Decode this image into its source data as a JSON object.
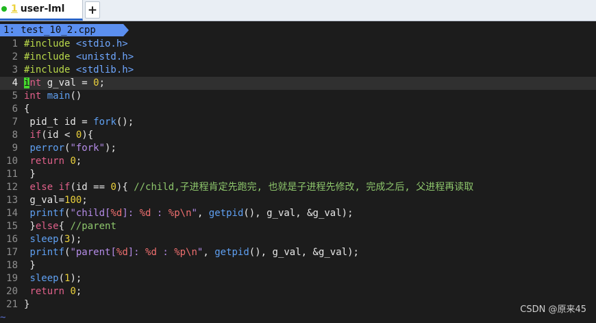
{
  "tabs": [
    {
      "number": "1",
      "label": "user-lml",
      "status_color": "#1fb81f"
    }
  ],
  "new_tab_label": "+",
  "buffer": {
    "label": "1: test_10_2.cpp",
    "color": "#5b8ff0"
  },
  "current_line": 4,
  "lines": [
    {
      "n": "1",
      "tokens": [
        {
          "t": "pre",
          "v": "#include "
        },
        {
          "t": "hdr",
          "v": "<stdio.h>"
        }
      ]
    },
    {
      "n": "2",
      "tokens": [
        {
          "t": "pre",
          "v": "#include "
        },
        {
          "t": "hdr",
          "v": "<unistd.h>"
        }
      ]
    },
    {
      "n": "3",
      "tokens": [
        {
          "t": "pre",
          "v": "#include "
        },
        {
          "t": "hdr",
          "v": "<stdlib.h>"
        }
      ]
    },
    {
      "n": "4",
      "tokens": [
        {
          "t": "cursor",
          "v": "i"
        },
        {
          "t": "kw",
          "v": "nt"
        },
        {
          "t": "pl",
          "v": " g_val = "
        },
        {
          "t": "num",
          "v": "0"
        },
        {
          "t": "pl",
          "v": ";"
        }
      ]
    },
    {
      "n": "5",
      "tokens": [
        {
          "t": "kw",
          "v": "int"
        },
        {
          "t": "pl",
          "v": " "
        },
        {
          "t": "fn",
          "v": "main"
        },
        {
          "t": "pl",
          "v": "()"
        }
      ]
    },
    {
      "n": "6",
      "tokens": [
        {
          "t": "pl",
          "v": "{"
        }
      ]
    },
    {
      "n": "7",
      "tokens": [
        {
          "t": "pl",
          "v": " pid_t id = "
        },
        {
          "t": "fn",
          "v": "fork"
        },
        {
          "t": "pl",
          "v": "();"
        }
      ]
    },
    {
      "n": "8",
      "tokens": [
        {
          "t": "pl",
          "v": " "
        },
        {
          "t": "kw",
          "v": "if"
        },
        {
          "t": "pl",
          "v": "(id < "
        },
        {
          "t": "num",
          "v": "0"
        },
        {
          "t": "pl",
          "v": "){"
        }
      ]
    },
    {
      "n": "9",
      "tokens": [
        {
          "t": "pl",
          "v": " "
        },
        {
          "t": "fn",
          "v": "perror"
        },
        {
          "t": "pl",
          "v": "("
        },
        {
          "t": "str",
          "v": "\"fork\""
        },
        {
          "t": "pl",
          "v": ");"
        }
      ]
    },
    {
      "n": "10",
      "tokens": [
        {
          "t": "pl",
          "v": " "
        },
        {
          "t": "kw",
          "v": "return"
        },
        {
          "t": "pl",
          "v": " "
        },
        {
          "t": "num",
          "v": "0"
        },
        {
          "t": "pl",
          "v": ";"
        }
      ]
    },
    {
      "n": "11",
      "tokens": [
        {
          "t": "pl",
          "v": " }"
        }
      ]
    },
    {
      "n": "12",
      "tokens": [
        {
          "t": "pl",
          "v": " "
        },
        {
          "t": "kw",
          "v": "else"
        },
        {
          "t": "pl",
          "v": " "
        },
        {
          "t": "kw",
          "v": "if"
        },
        {
          "t": "pl",
          "v": "(id == "
        },
        {
          "t": "num",
          "v": "0"
        },
        {
          "t": "pl",
          "v": "){ "
        },
        {
          "t": "cm",
          "v": "//child,子进程肯定先跑完, 也就是子进程先修改, 完成之后, 父进程再读取"
        }
      ]
    },
    {
      "n": "13",
      "tokens": [
        {
          "t": "pl",
          "v": " g_val="
        },
        {
          "t": "num",
          "v": "100"
        },
        {
          "t": "pl",
          "v": ";"
        }
      ]
    },
    {
      "n": "14",
      "tokens": [
        {
          "t": "pl",
          "v": " "
        },
        {
          "t": "fn",
          "v": "printf"
        },
        {
          "t": "pl",
          "v": "("
        },
        {
          "t": "str",
          "v": "\"child["
        },
        {
          "t": "fmt",
          "v": "%d"
        },
        {
          "t": "str",
          "v": "]: "
        },
        {
          "t": "fmt",
          "v": "%d"
        },
        {
          "t": "str",
          "v": " : "
        },
        {
          "t": "fmt",
          "v": "%p\\n"
        },
        {
          "t": "str",
          "v": "\""
        },
        {
          "t": "pl",
          "v": ", "
        },
        {
          "t": "fn",
          "v": "getpid"
        },
        {
          "t": "pl",
          "v": "(), g_val, &g_val);"
        }
      ]
    },
    {
      "n": "15",
      "tokens": [
        {
          "t": "pl",
          "v": " }"
        },
        {
          "t": "kw",
          "v": "else"
        },
        {
          "t": "pl",
          "v": "{ "
        },
        {
          "t": "cm",
          "v": "//parent"
        }
      ]
    },
    {
      "n": "16",
      "tokens": [
        {
          "t": "pl",
          "v": " "
        },
        {
          "t": "fn",
          "v": "sleep"
        },
        {
          "t": "pl",
          "v": "("
        },
        {
          "t": "num",
          "v": "3"
        },
        {
          "t": "pl",
          "v": ");"
        }
      ]
    },
    {
      "n": "17",
      "tokens": [
        {
          "t": "pl",
          "v": " "
        },
        {
          "t": "fn",
          "v": "printf"
        },
        {
          "t": "pl",
          "v": "("
        },
        {
          "t": "str",
          "v": "\"parent["
        },
        {
          "t": "fmt",
          "v": "%d"
        },
        {
          "t": "str",
          "v": "]: "
        },
        {
          "t": "fmt",
          "v": "%d"
        },
        {
          "t": "str",
          "v": " : "
        },
        {
          "t": "fmt",
          "v": "%p\\n"
        },
        {
          "t": "str",
          "v": "\""
        },
        {
          "t": "pl",
          "v": ", "
        },
        {
          "t": "fn",
          "v": "getpid"
        },
        {
          "t": "pl",
          "v": "(), g_val, &g_val);"
        }
      ]
    },
    {
      "n": "18",
      "tokens": [
        {
          "t": "pl",
          "v": " }"
        }
      ]
    },
    {
      "n": "19",
      "tokens": [
        {
          "t": "pl",
          "v": " "
        },
        {
          "t": "fn",
          "v": "sleep"
        },
        {
          "t": "pl",
          "v": "("
        },
        {
          "t": "num",
          "v": "1"
        },
        {
          "t": "pl",
          "v": ");"
        }
      ]
    },
    {
      "n": "20",
      "tokens": [
        {
          "t": "pl",
          "v": " "
        },
        {
          "t": "kw",
          "v": "return"
        },
        {
          "t": "pl",
          "v": " "
        },
        {
          "t": "num",
          "v": "0"
        },
        {
          "t": "pl",
          "v": ";"
        }
      ]
    },
    {
      "n": "21",
      "tokens": [
        {
          "t": "pl",
          "v": "}"
        }
      ]
    }
  ],
  "empty_line_marker": "~",
  "watermark": "CSDN @原来45"
}
